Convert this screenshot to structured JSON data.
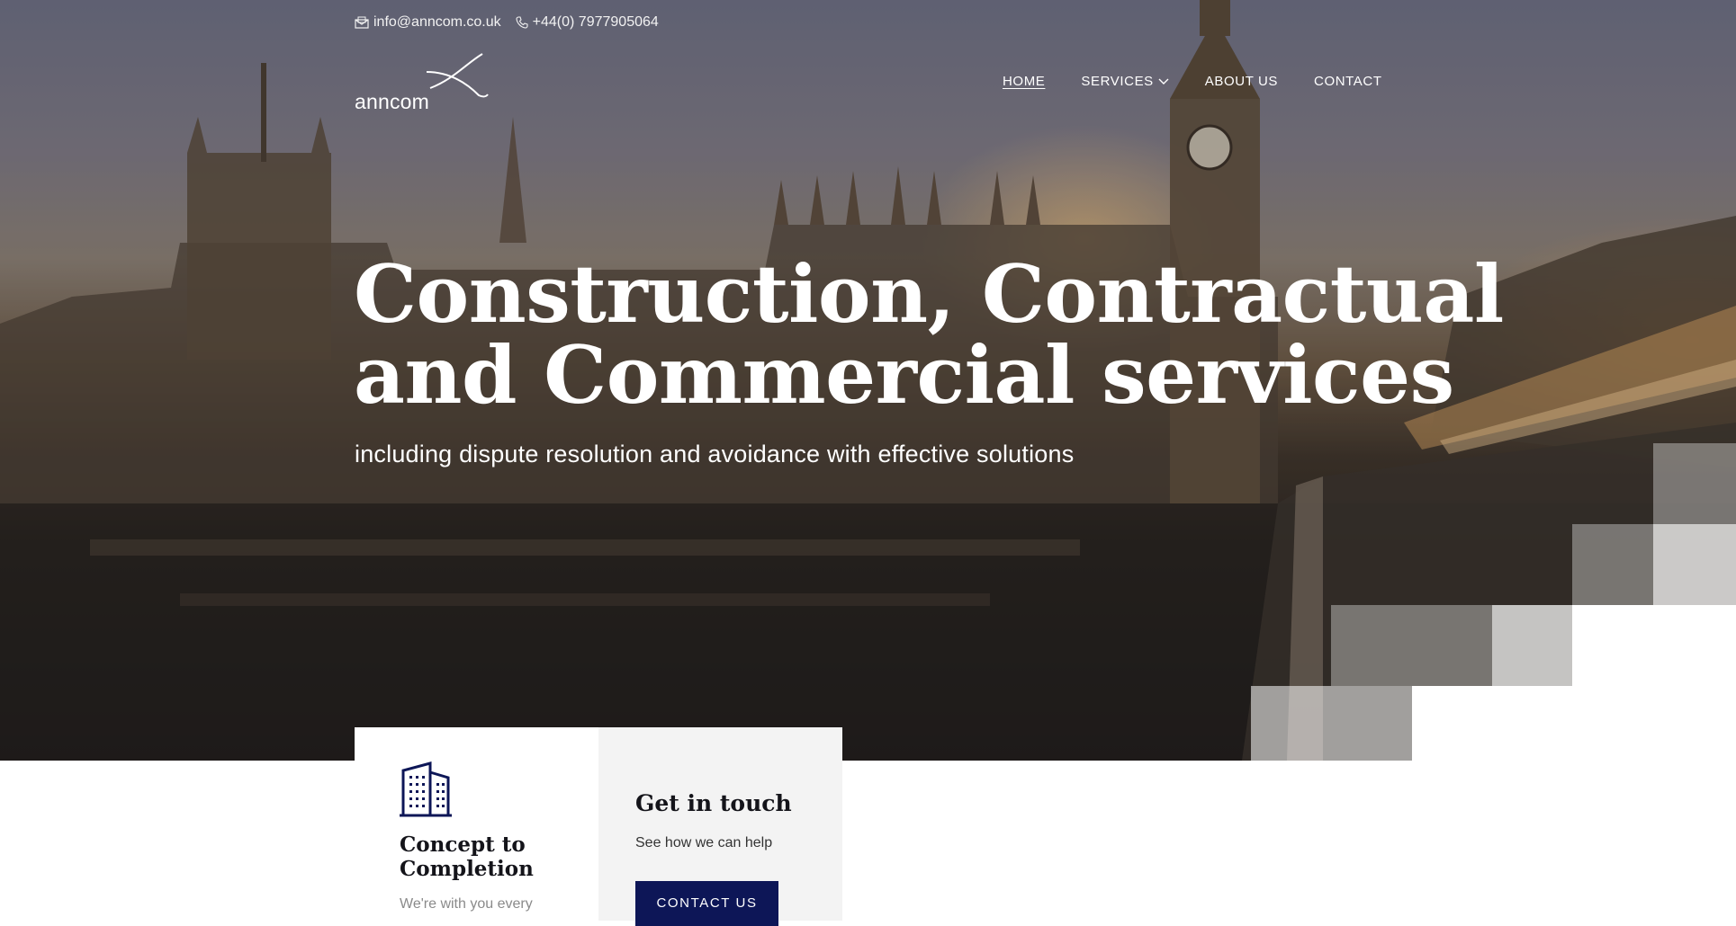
{
  "topbar": {
    "email": "info@anncom.co.uk",
    "phone": "+44(0) 7977905064"
  },
  "logo": {
    "text": "anncom"
  },
  "nav": {
    "items": [
      {
        "label": "HOME",
        "active": true
      },
      {
        "label": "SERVICES",
        "has_dropdown": true
      },
      {
        "label": "ABOUT US"
      },
      {
        "label": "CONTACT"
      }
    ]
  },
  "hero": {
    "headline_line1": "Construction, Contractual",
    "headline_line2": "and Commercial services",
    "subheadline": "including dispute resolution and avoidance with effective solutions"
  },
  "card_concept": {
    "icon": "building-icon",
    "title": "Concept to Completion",
    "description": "We're with you every"
  },
  "card_touch": {
    "title": "Get in touch",
    "description": "See how we can help",
    "button_label": "CONTACT US"
  },
  "colors": {
    "brand_navy": "#0d1657",
    "white": "#ffffff",
    "card_grey": "#f3f3f3"
  }
}
